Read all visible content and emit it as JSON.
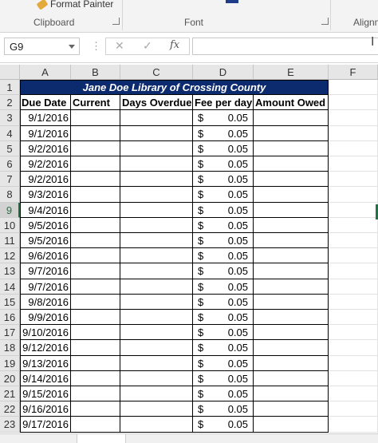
{
  "ribbon": {
    "format_painter": "Format Painter",
    "groups": [
      "Clipboard",
      "Font",
      "Alignm"
    ]
  },
  "formula_bar": {
    "name_box": "G9",
    "more_dots": "⋮",
    "cancel": "✕",
    "enter": "✓",
    "fx": "fx",
    "formula": ""
  },
  "columns": [
    "A",
    "B",
    "C",
    "D",
    "E",
    "F"
  ],
  "selected_row": 9,
  "sheet": {
    "title": "Jane Doe Library of Crossing County",
    "headers": [
      "Due Date",
      "Current",
      "Days Overdue",
      "Fee per day",
      "Amount Owed"
    ],
    "currency_symbol": "$",
    "rows": [
      {
        "row": "3",
        "due": "9/1/2016",
        "fee": "0.05"
      },
      {
        "row": "4",
        "due": "9/1/2016",
        "fee": "0.05"
      },
      {
        "row": "5",
        "due": "9/2/2016",
        "fee": "0.05"
      },
      {
        "row": "6",
        "due": "9/2/2016",
        "fee": "0.05"
      },
      {
        "row": "7",
        "due": "9/2/2016",
        "fee": "0.05"
      },
      {
        "row": "8",
        "due": "9/3/2016",
        "fee": "0.05"
      },
      {
        "row": "9",
        "due": "9/4/2016",
        "fee": "0.05"
      },
      {
        "row": "10",
        "due": "9/5/2016",
        "fee": "0.05"
      },
      {
        "row": "11",
        "due": "9/5/2016",
        "fee": "0.05"
      },
      {
        "row": "12",
        "due": "9/6/2016",
        "fee": "0.05"
      },
      {
        "row": "13",
        "due": "9/7/2016",
        "fee": "0.05"
      },
      {
        "row": "14",
        "due": "9/7/2016",
        "fee": "0.05"
      },
      {
        "row": "15",
        "due": "9/8/2016",
        "fee": "0.05"
      },
      {
        "row": "16",
        "due": "9/9/2016",
        "fee": "0.05"
      },
      {
        "row": "17",
        "due": "9/10/2016",
        "fee": "0.05"
      },
      {
        "row": "18",
        "due": "9/12/2016",
        "fee": "0.05"
      },
      {
        "row": "19",
        "due": "9/13/2016",
        "fee": "0.05"
      },
      {
        "row": "20",
        "due": "9/14/2016",
        "fee": "0.05"
      },
      {
        "row": "21",
        "due": "9/15/2016",
        "fee": "0.05"
      },
      {
        "row": "22",
        "due": "9/16/2016",
        "fee": "0.05"
      },
      {
        "row": "23",
        "due": "9/17/2016",
        "fee": "0.05"
      }
    ]
  },
  "colors": {
    "title_bg": "#0c2a6e",
    "title_fg": "#ffffff",
    "selection_green": "#217346"
  }
}
